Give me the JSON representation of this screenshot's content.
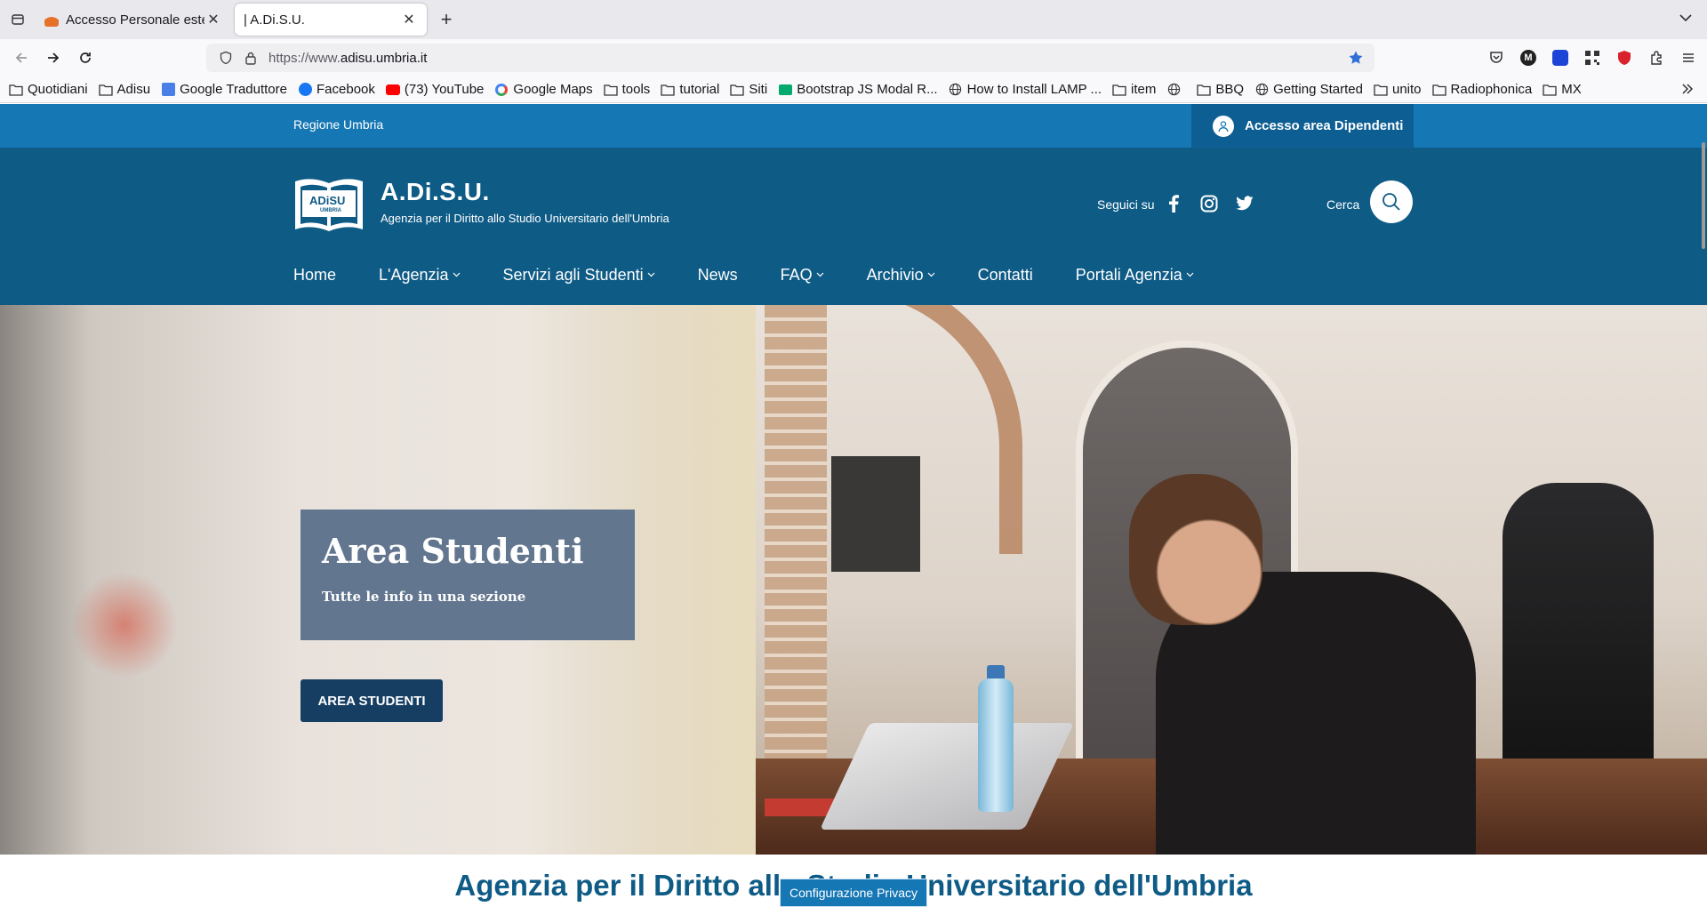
{
  "browser": {
    "tabs": [
      {
        "title": "Accesso Personale estern",
        "active": false
      },
      {
        "title": "| A.Di.S.U.",
        "active": true
      }
    ],
    "new_tab": "+",
    "url_prefix": "https://www.",
    "url_host": "adisu.umbria.it",
    "bookmarks": [
      {
        "label": "Quotidiani",
        "icon": "folder-icon"
      },
      {
        "label": "Adisu",
        "icon": "folder-icon"
      },
      {
        "label": "Google Traduttore",
        "icon": "google-translate-icon"
      },
      {
        "label": "Facebook",
        "icon": "facebook-icon"
      },
      {
        "label": "(73) YouTube",
        "icon": "youtube-icon"
      },
      {
        "label": "Google Maps",
        "icon": "google-icon"
      },
      {
        "label": "tools",
        "icon": "folder-icon"
      },
      {
        "label": "tutorial",
        "icon": "folder-icon"
      },
      {
        "label": "Siti",
        "icon": "folder-icon"
      },
      {
        "label": "Bootstrap JS Modal R...",
        "icon": "w3-icon"
      },
      {
        "label": "How to Install LAMP ...",
        "icon": "globe-icon"
      },
      {
        "label": "item",
        "icon": "folder-icon"
      },
      {
        "label": "",
        "icon": "globe-icon"
      },
      {
        "label": "BBQ",
        "icon": "folder-icon"
      },
      {
        "label": "Getting Started",
        "icon": "globe-icon"
      },
      {
        "label": "unito",
        "icon": "folder-icon"
      },
      {
        "label": "Radiophonica",
        "icon": "folder-icon"
      },
      {
        "label": "MX",
        "icon": "folder-icon"
      }
    ]
  },
  "site": {
    "topbar": {
      "regione": "Regione Umbria",
      "access": "Accesso area Dipendenti"
    },
    "header": {
      "logo_text": "ADiSU",
      "logo_sub": "UMBRIA",
      "name": "A.Di.S.U.",
      "subtitle": "Agenzia per il Diritto allo Studio Universitario dell'Umbria",
      "follow": "Seguici su",
      "search_label": "Cerca"
    },
    "menu": [
      {
        "label": "Home",
        "dropdown": false
      },
      {
        "label": "L'Agenzia",
        "dropdown": true
      },
      {
        "label": "Servizi agli Studenti",
        "dropdown": true
      },
      {
        "label": "News",
        "dropdown": false
      },
      {
        "label": "FAQ",
        "dropdown": true
      },
      {
        "label": "Archivio",
        "dropdown": true
      },
      {
        "label": "Contatti",
        "dropdown": false
      },
      {
        "label": "Portali Agenzia",
        "dropdown": true
      }
    ],
    "hero": {
      "title": "Area Studenti",
      "subtitle": "Tutte le info in una sezione",
      "button": "AREA STUDENTI"
    },
    "bottom_title": "Agenzia per il Diritto allo Studio Universitario dell'Umbria",
    "privacy_button": "Configurazione Privacy"
  },
  "colors": {
    "topbar": "#1677b5",
    "header": "#0e5b86",
    "hero_card": "#5b708a",
    "hero_button": "#163e63"
  }
}
